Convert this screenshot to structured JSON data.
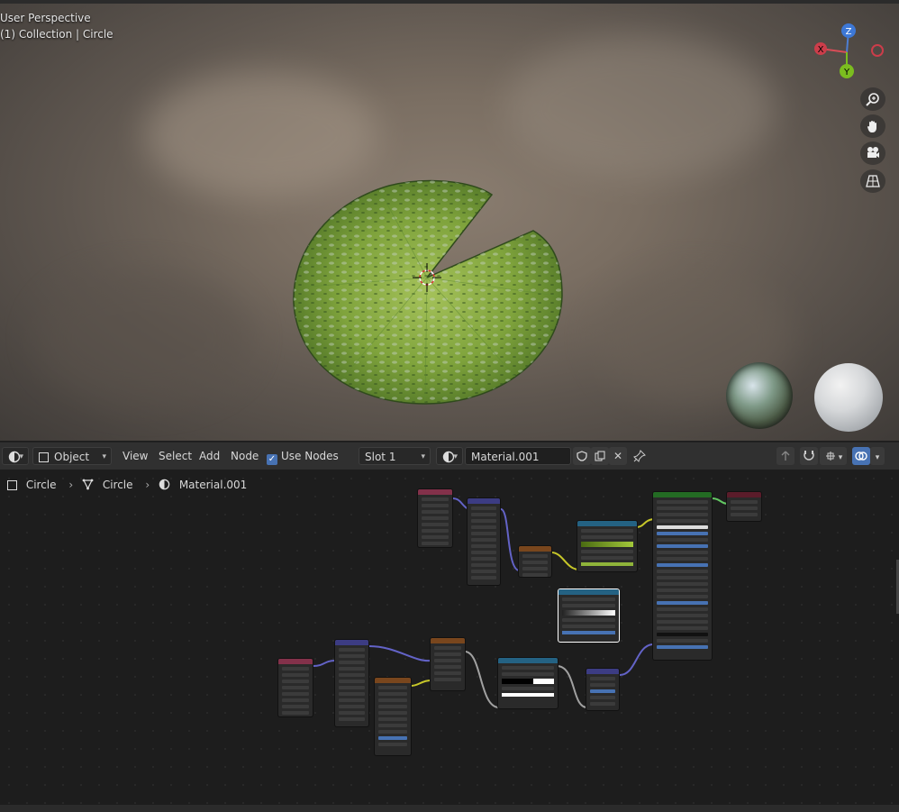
{
  "viewport": {
    "perspective_label": "User Perspective",
    "collection_label": "(1) Collection | Circle",
    "gizmo": {
      "x": "X",
      "y": "Y",
      "z": "Z"
    },
    "nav_icons": [
      "zoom-icon",
      "hand-icon",
      "camera-icon",
      "grid-icon"
    ]
  },
  "header": {
    "editor_type_icon": "node-editor-icon",
    "mode_label": "Object",
    "menu": [
      "View",
      "Select",
      "Add",
      "Node"
    ],
    "use_nodes_label": "Use Nodes",
    "slot_label": "Slot 1",
    "material_name": "Material.001"
  },
  "breadcrumb": {
    "object": "Circle",
    "mesh": "Circle",
    "material": "Material.001"
  },
  "colors": {
    "accent": "#4772b3",
    "header_bg": "#303030",
    "node_bg": "#2a2a2a",
    "grid_bg": "#1d1d1d",
    "node_texcoord": "#83314a",
    "node_mapping": "#3c3c83",
    "node_texture": "#79461d",
    "node_colorramp": "#246283",
    "node_shader": "#236b23",
    "node_output": "#5a1c2a"
  }
}
